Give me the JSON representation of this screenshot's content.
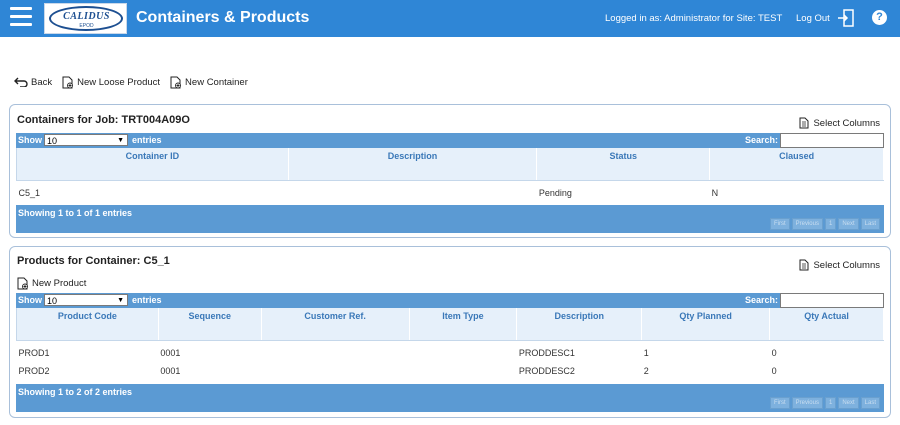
{
  "header": {
    "logo_text": "CALIDUS",
    "logo_sub": "EPOD",
    "title": "Containers & Products",
    "login_info": "Logged in as: Administrator for Site: TEST",
    "logout_label": "Log Out",
    "help_label": "?"
  },
  "toolbar": {
    "back": "Back",
    "new_loose_product": "New Loose Product",
    "new_container": "New Container"
  },
  "containers": {
    "title": "Containers for Job: TRT004A09O",
    "select_columns": "Select Columns",
    "show_label": "Show",
    "length_value": "10",
    "entries_label": "entries",
    "search_label": "Search:",
    "columns": [
      "Container ID",
      "Description",
      "Status",
      "Claused"
    ],
    "rows": [
      [
        "C5_1",
        "",
        "Pending",
        "N"
      ]
    ],
    "info": "Showing 1 to 1 of 1 entries",
    "pager": [
      "First",
      "Previous",
      "1",
      "Next",
      "Last"
    ]
  },
  "products": {
    "title": "Products for Container: C5_1",
    "select_columns": "Select Columns",
    "new_product": "New Product",
    "show_label": "Show",
    "length_value": "10",
    "entries_label": "entries",
    "search_label": "Search:",
    "columns": [
      "Product Code",
      "Sequence",
      "Customer Ref.",
      "Item Type",
      "Description",
      "Qty Planned",
      "Qty Actual"
    ],
    "rows": [
      [
        "PROD1",
        "0001",
        "",
        "",
        "PRODDESC1",
        "1",
        "0"
      ],
      [
        "PROD2",
        "0001",
        "",
        "",
        "PRODDESC2",
        "2",
        "0"
      ]
    ],
    "info": "Showing 1 to 2 of 2 entries",
    "pager": [
      "First",
      "Previous",
      "1",
      "Next",
      "Last"
    ]
  }
}
